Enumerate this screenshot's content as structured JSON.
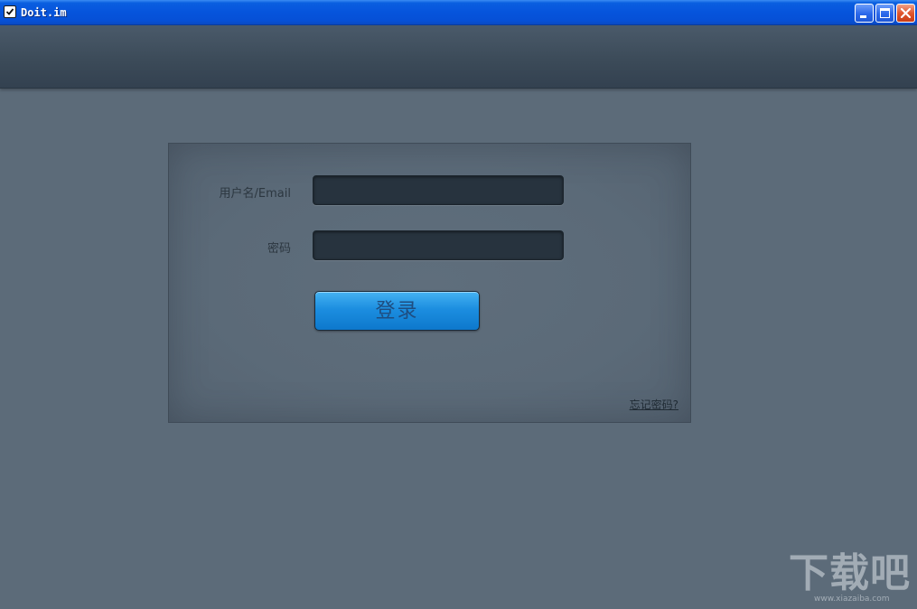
{
  "window": {
    "title": "Doit.im",
    "icon": "checkbox-icon",
    "controls": {
      "minimize": "minimize-icon",
      "maximize": "maximize-icon",
      "close": "close-icon"
    }
  },
  "login": {
    "username_label": "用户名/Email",
    "username_value": "",
    "password_label": "密码",
    "password_value": "",
    "submit_label": "登录",
    "forgot_label": "忘记密码?"
  },
  "watermark": {
    "main": "下载吧",
    "sub": "www.xiazaiba.com"
  },
  "colors": {
    "titlebar": "#0654dc",
    "background": "#5c6b79",
    "header": "#3c4b59",
    "input": "#27333e",
    "button": "#1c8ee0"
  }
}
